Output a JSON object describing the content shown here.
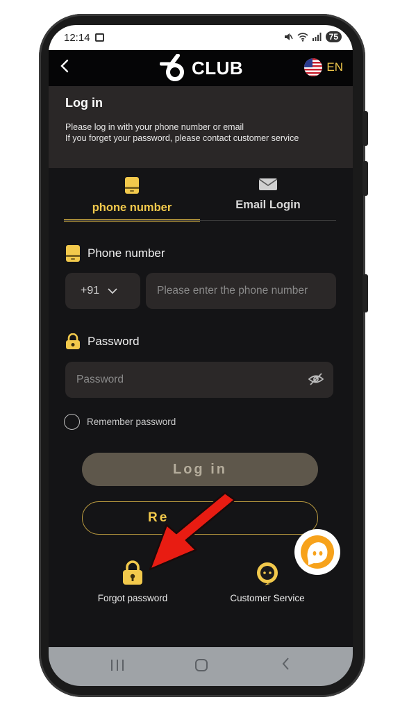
{
  "status_bar": {
    "time": "12:14",
    "battery": "75"
  },
  "header": {
    "logo_text": "CLUB",
    "language": "EN"
  },
  "info": {
    "title": "Log in",
    "line1": "Please log in with your phone number or email",
    "line2": "If you forget your password, please contact customer service"
  },
  "tabs": [
    {
      "label": "phone number",
      "active": true,
      "icon": "phone-icon"
    },
    {
      "label": "Email Login",
      "active": false,
      "icon": "mail-icon"
    }
  ],
  "form": {
    "phone_label": "Phone number",
    "country_code": "+91",
    "phone_placeholder": "Please enter the phone number",
    "password_label": "Password",
    "password_placeholder": "Password",
    "remember_label": "Remember password"
  },
  "buttons": {
    "login": "Log in",
    "register_visible": "Re"
  },
  "quick_links": [
    {
      "label": "Forgot password",
      "icon": "lock-icon"
    },
    {
      "label": "Customer Service",
      "icon": "headset-icon"
    }
  ],
  "colors": {
    "accent": "#f2c94c",
    "background": "#141416",
    "panel": "#2a2727",
    "arrow": "#e81c12"
  }
}
